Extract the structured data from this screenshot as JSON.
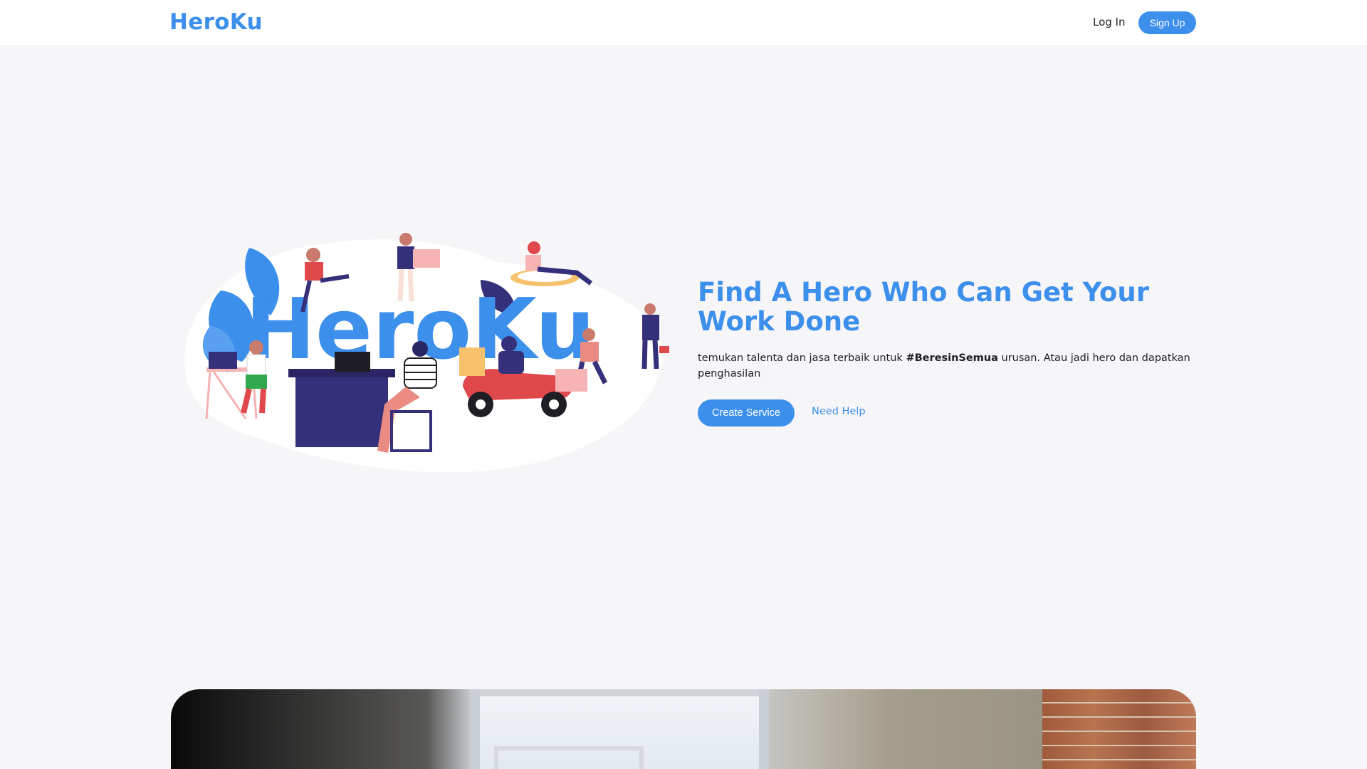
{
  "navbar": {
    "brand": "HeroKu",
    "login": "Log In",
    "signup": "Sign Up"
  },
  "hero": {
    "illustration_text": "HeroKu",
    "title": "Find A Hero Who Can Get Your Work Done",
    "desc_before": "temukan talenta dan jasa terbaik untuk ",
    "desc_hashtag": "#BeresinSemua",
    "desc_after": " urusan. Atau jadi hero dan dapatkan penghasilan",
    "create_button": "Create Service",
    "help_link": "Need Help"
  },
  "colors": {
    "accent": "#3d8fec",
    "background": "#f6f6f9",
    "navy": "#35307a",
    "coral": "#e0494b",
    "pink": "#f6b3b3"
  }
}
